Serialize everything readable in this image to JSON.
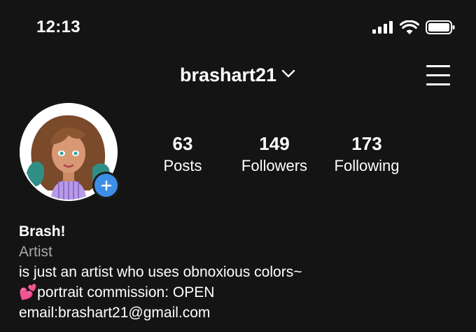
{
  "status_bar": {
    "time": "12:13",
    "icons": [
      "cellular-signal-icon",
      "wifi-icon",
      "battery-icon"
    ]
  },
  "header": {
    "username": "brashart21",
    "dropdown_icon": "chevron-down-icon",
    "menu_icon": "hamburger-menu-icon"
  },
  "profile": {
    "avatar": "profile-avatar",
    "add_icon": "plus-icon",
    "stats": [
      {
        "count": "63",
        "label": "Posts"
      },
      {
        "count": "149",
        "label": "Followers"
      },
      {
        "count": "173",
        "label": "Following"
      }
    ]
  },
  "bio": {
    "name": "Brash!",
    "category": "Artist",
    "line1": "is just an artist who uses obnoxious colors~",
    "line2_emoji": "💕",
    "line2": "portrait commission: OPEN",
    "line3": "email:brashart21@gmail.com"
  },
  "colors": {
    "background": "#141414",
    "accent": "#3d8fe6",
    "muted": "#a8a8a8"
  }
}
